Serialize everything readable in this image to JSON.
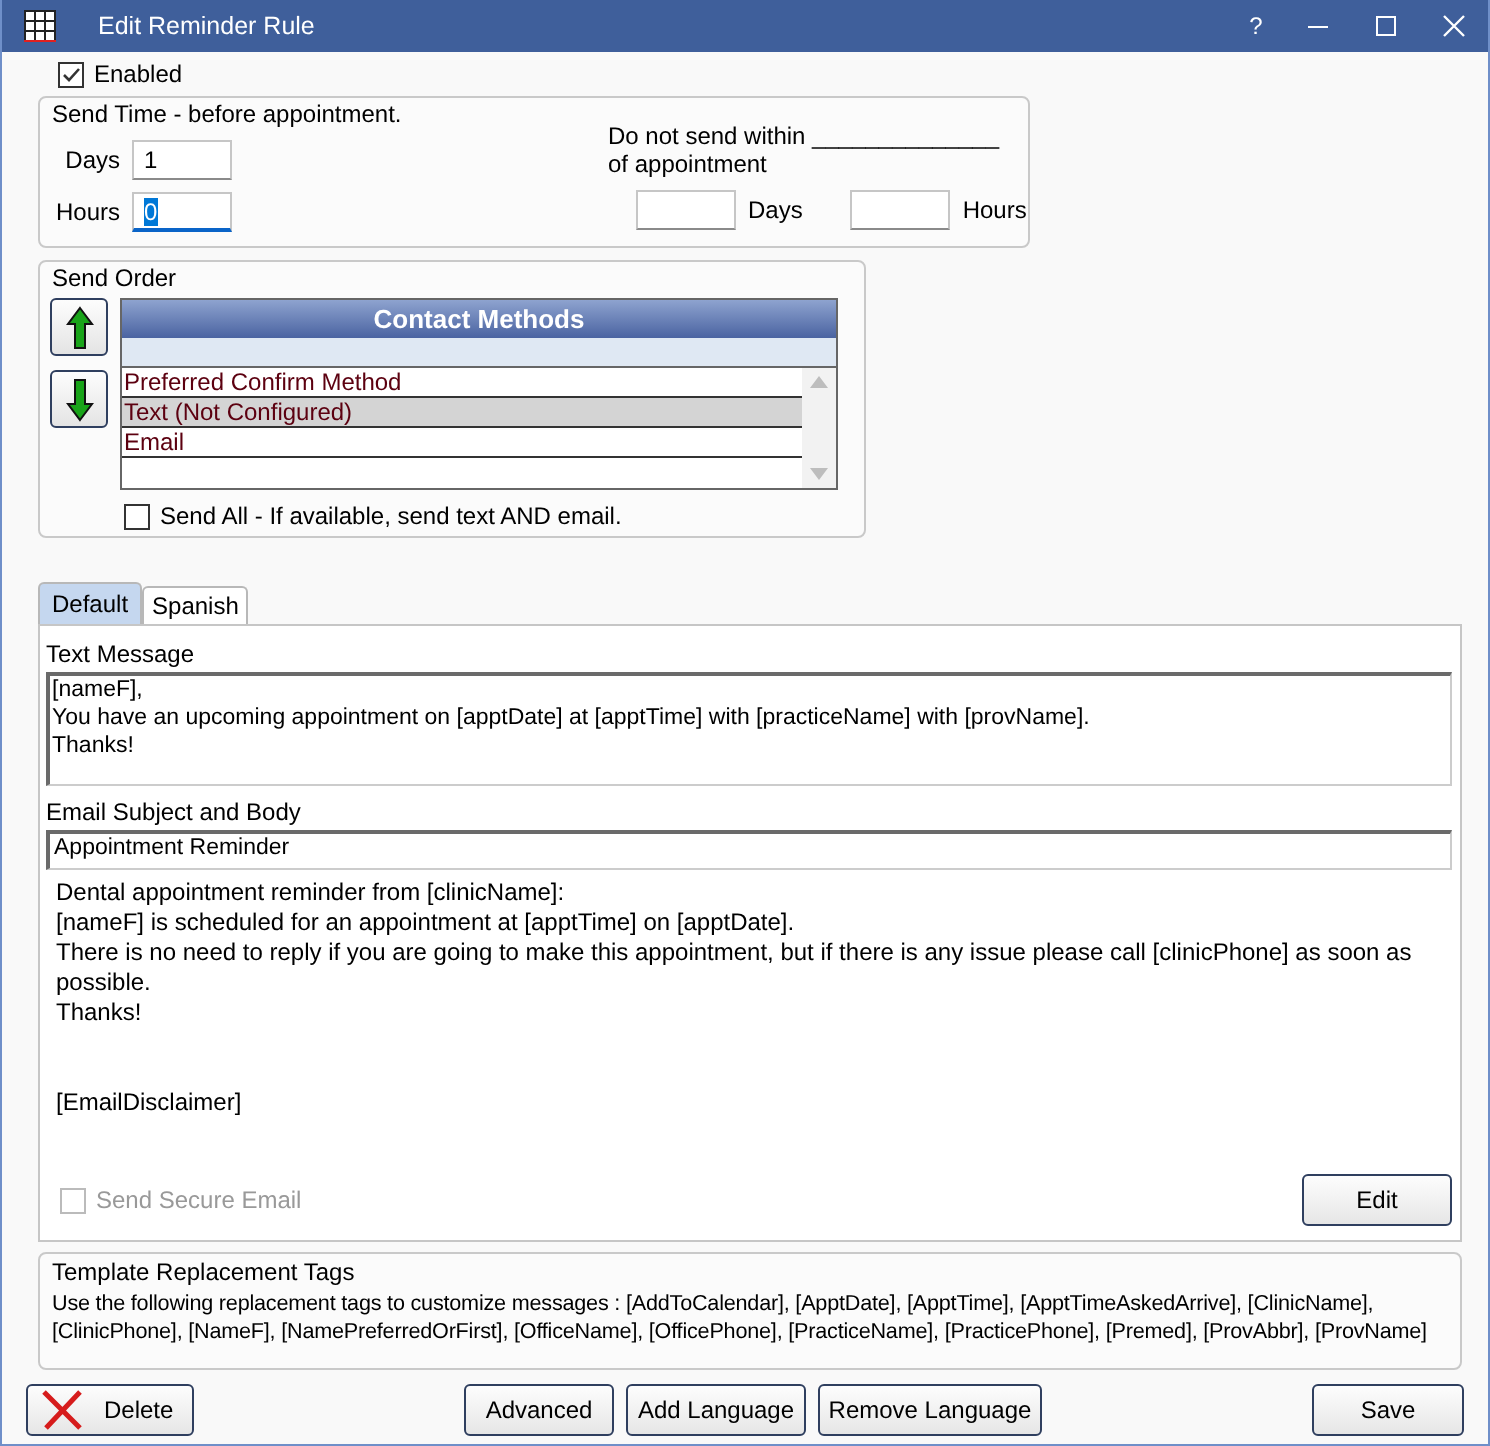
{
  "window": {
    "title": "Edit Reminder Rule",
    "help": "?"
  },
  "enabled": {
    "label": "Enabled",
    "checked": true
  },
  "send_time": {
    "title": "Send Time - before appointment.",
    "days": {
      "label": "Days",
      "value": "1",
      "focused": false
    },
    "hours": {
      "label": "Hours",
      "value": "0",
      "focused": true
    },
    "do_not_send": {
      "text": "Do not send within ______________ of appointment",
      "days_label": "Days",
      "hours_label": "Hours"
    }
  },
  "send_order": {
    "title": "Send Order",
    "grid_title": "Contact Methods",
    "methods": [
      {
        "label": "Preferred Confirm Method",
        "selected": false
      },
      {
        "label": "Text (Not Configured)",
        "selected": true
      },
      {
        "label": "Email",
        "selected": false
      }
    ],
    "send_all": {
      "label": "Send All - If available, send text AND email.",
      "checked": false
    }
  },
  "tabs": [
    {
      "label": "Default",
      "selected": true
    },
    {
      "label": "Spanish",
      "selected": false
    }
  ],
  "text_message": {
    "label": "Text Message",
    "value": "[nameF],\nYou have an upcoming appointment on [apptDate] at [apptTime] with [practiceName] with [provName].\nThanks!"
  },
  "email": {
    "label": "Email Subject and Body",
    "subject": "Appointment Reminder",
    "body": "Dental appointment reminder from [clinicName]:\n[nameF] is scheduled for an appointment at [apptTime] on [apptDate].\nThere is no need to reply if you are going to make this appointment, but if there is any issue please call [clinicPhone] as soon as possible.\nThanks!\n\n\n[EmailDisclaimer]"
  },
  "send_secure_email": {
    "label": "Send Secure Email",
    "checked": false,
    "disabled": true
  },
  "edit_button": "Edit",
  "tags": {
    "title": "Template Replacement Tags",
    "text": "Use the following replacement tags to customize messages : [AddToCalendar], [ApptDate], [ApptTime], [ApptTimeAskedArrive], [ClinicName], [ClinicPhone], [NameF], [NamePreferredOrFirst], [OfficeName], [OfficePhone], [PracticeName], [PracticePhone], [Premed], [ProvAbbr], [ProvName]"
  },
  "buttons": [
    {
      "label": "Delete",
      "kind": "delete"
    },
    {
      "label": "Advanced",
      "kind": "middle"
    },
    {
      "label": "Add Language",
      "kind": "middle"
    },
    {
      "label": "Remove Language",
      "kind": "middle"
    },
    {
      "label": "Save",
      "kind": "right"
    }
  ]
}
